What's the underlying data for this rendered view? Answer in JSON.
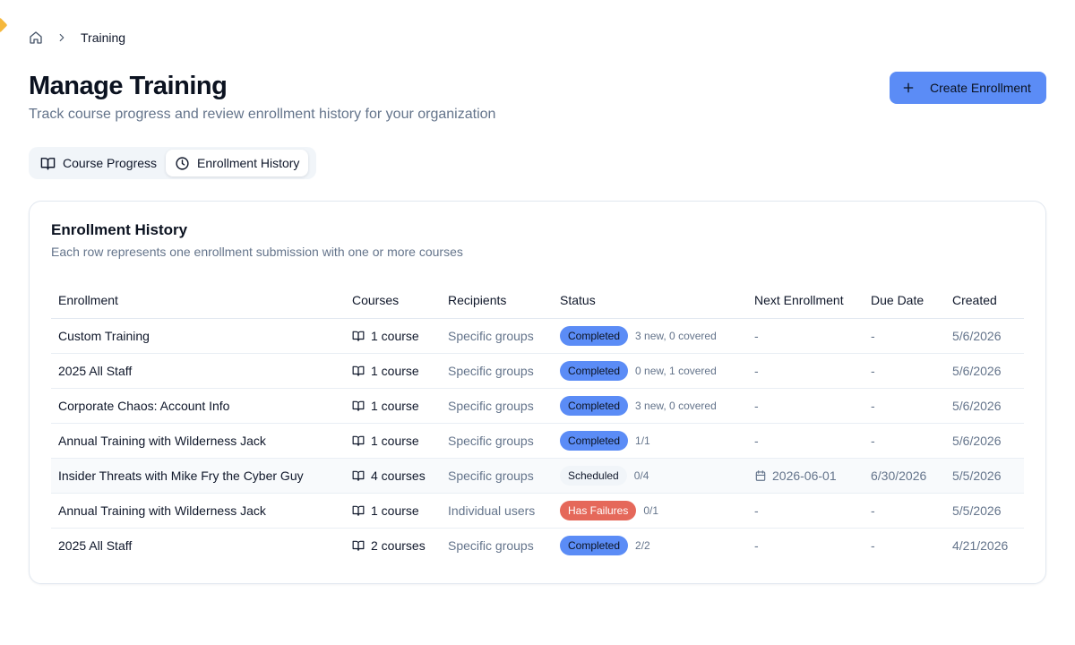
{
  "breadcrumb": {
    "home_icon": "home-icon",
    "separator_icon": "chevron-right-icon",
    "current": "Training"
  },
  "header": {
    "title": "Manage Training",
    "subtitle": "Track course progress and review enrollment history for your organization",
    "create_button": "Create Enrollment"
  },
  "tabs": [
    {
      "label": "Course Progress",
      "icon": "book-open-icon",
      "active": false
    },
    {
      "label": "Enrollment History",
      "icon": "clock-icon",
      "active": true
    }
  ],
  "card": {
    "title": "Enrollment History",
    "description": "Each row represents one enrollment submission with one or more courses"
  },
  "table": {
    "columns": [
      "Enrollment",
      "Courses",
      "Recipients",
      "Status",
      "Next Enrollment",
      "Due Date",
      "Created"
    ],
    "rows": [
      {
        "enrollment": "Custom Training",
        "courses": "1 course",
        "recipients": "Specific groups",
        "status": "Completed",
        "status_type": "completed",
        "status_note": "3 new, 0 covered",
        "next": "-",
        "due": "-",
        "created": "5/6/2026"
      },
      {
        "enrollment": "2025 All Staff",
        "courses": "1 course",
        "recipients": "Specific groups",
        "status": "Completed",
        "status_type": "completed",
        "status_note": "0 new, 1 covered",
        "next": "-",
        "due": "-",
        "created": "5/6/2026"
      },
      {
        "enrollment": "Corporate Chaos: Account Info",
        "courses": "1 course",
        "recipients": "Specific groups",
        "status": "Completed",
        "status_type": "completed",
        "status_note": "3 new, 0 covered",
        "next": "-",
        "due": "-",
        "created": "5/6/2026"
      },
      {
        "enrollment": "Annual Training with Wilderness Jack",
        "courses": "1 course",
        "recipients": "Specific groups",
        "status": "Completed",
        "status_type": "completed",
        "status_note": "1/1",
        "next": "-",
        "due": "-",
        "created": "5/6/2026"
      },
      {
        "enrollment": "Insider Threats with Mike Fry the Cyber Guy",
        "courses": "4 courses",
        "recipients": "Specific groups",
        "status": "Scheduled",
        "status_type": "scheduled",
        "status_note": "0/4",
        "next": "2026-06-01",
        "due": "6/30/2026",
        "created": "5/5/2026"
      },
      {
        "enrollment": "Annual Training with Wilderness Jack",
        "courses": "1 course",
        "recipients": "Individual users",
        "status": "Has Failures",
        "status_type": "failures",
        "status_note": "0/1",
        "next": "-",
        "due": "-",
        "created": "5/5/2026"
      },
      {
        "enrollment": "2025 All Staff",
        "courses": "2 courses",
        "recipients": "Specific groups",
        "status": "Completed",
        "status_type": "completed",
        "status_note": "2/2",
        "next": "-",
        "due": "-",
        "created": "4/21/2026"
      }
    ]
  },
  "colors": {
    "accent": "#5b8cf6",
    "failure": "#e5685a",
    "muted_text": "#64748b"
  }
}
